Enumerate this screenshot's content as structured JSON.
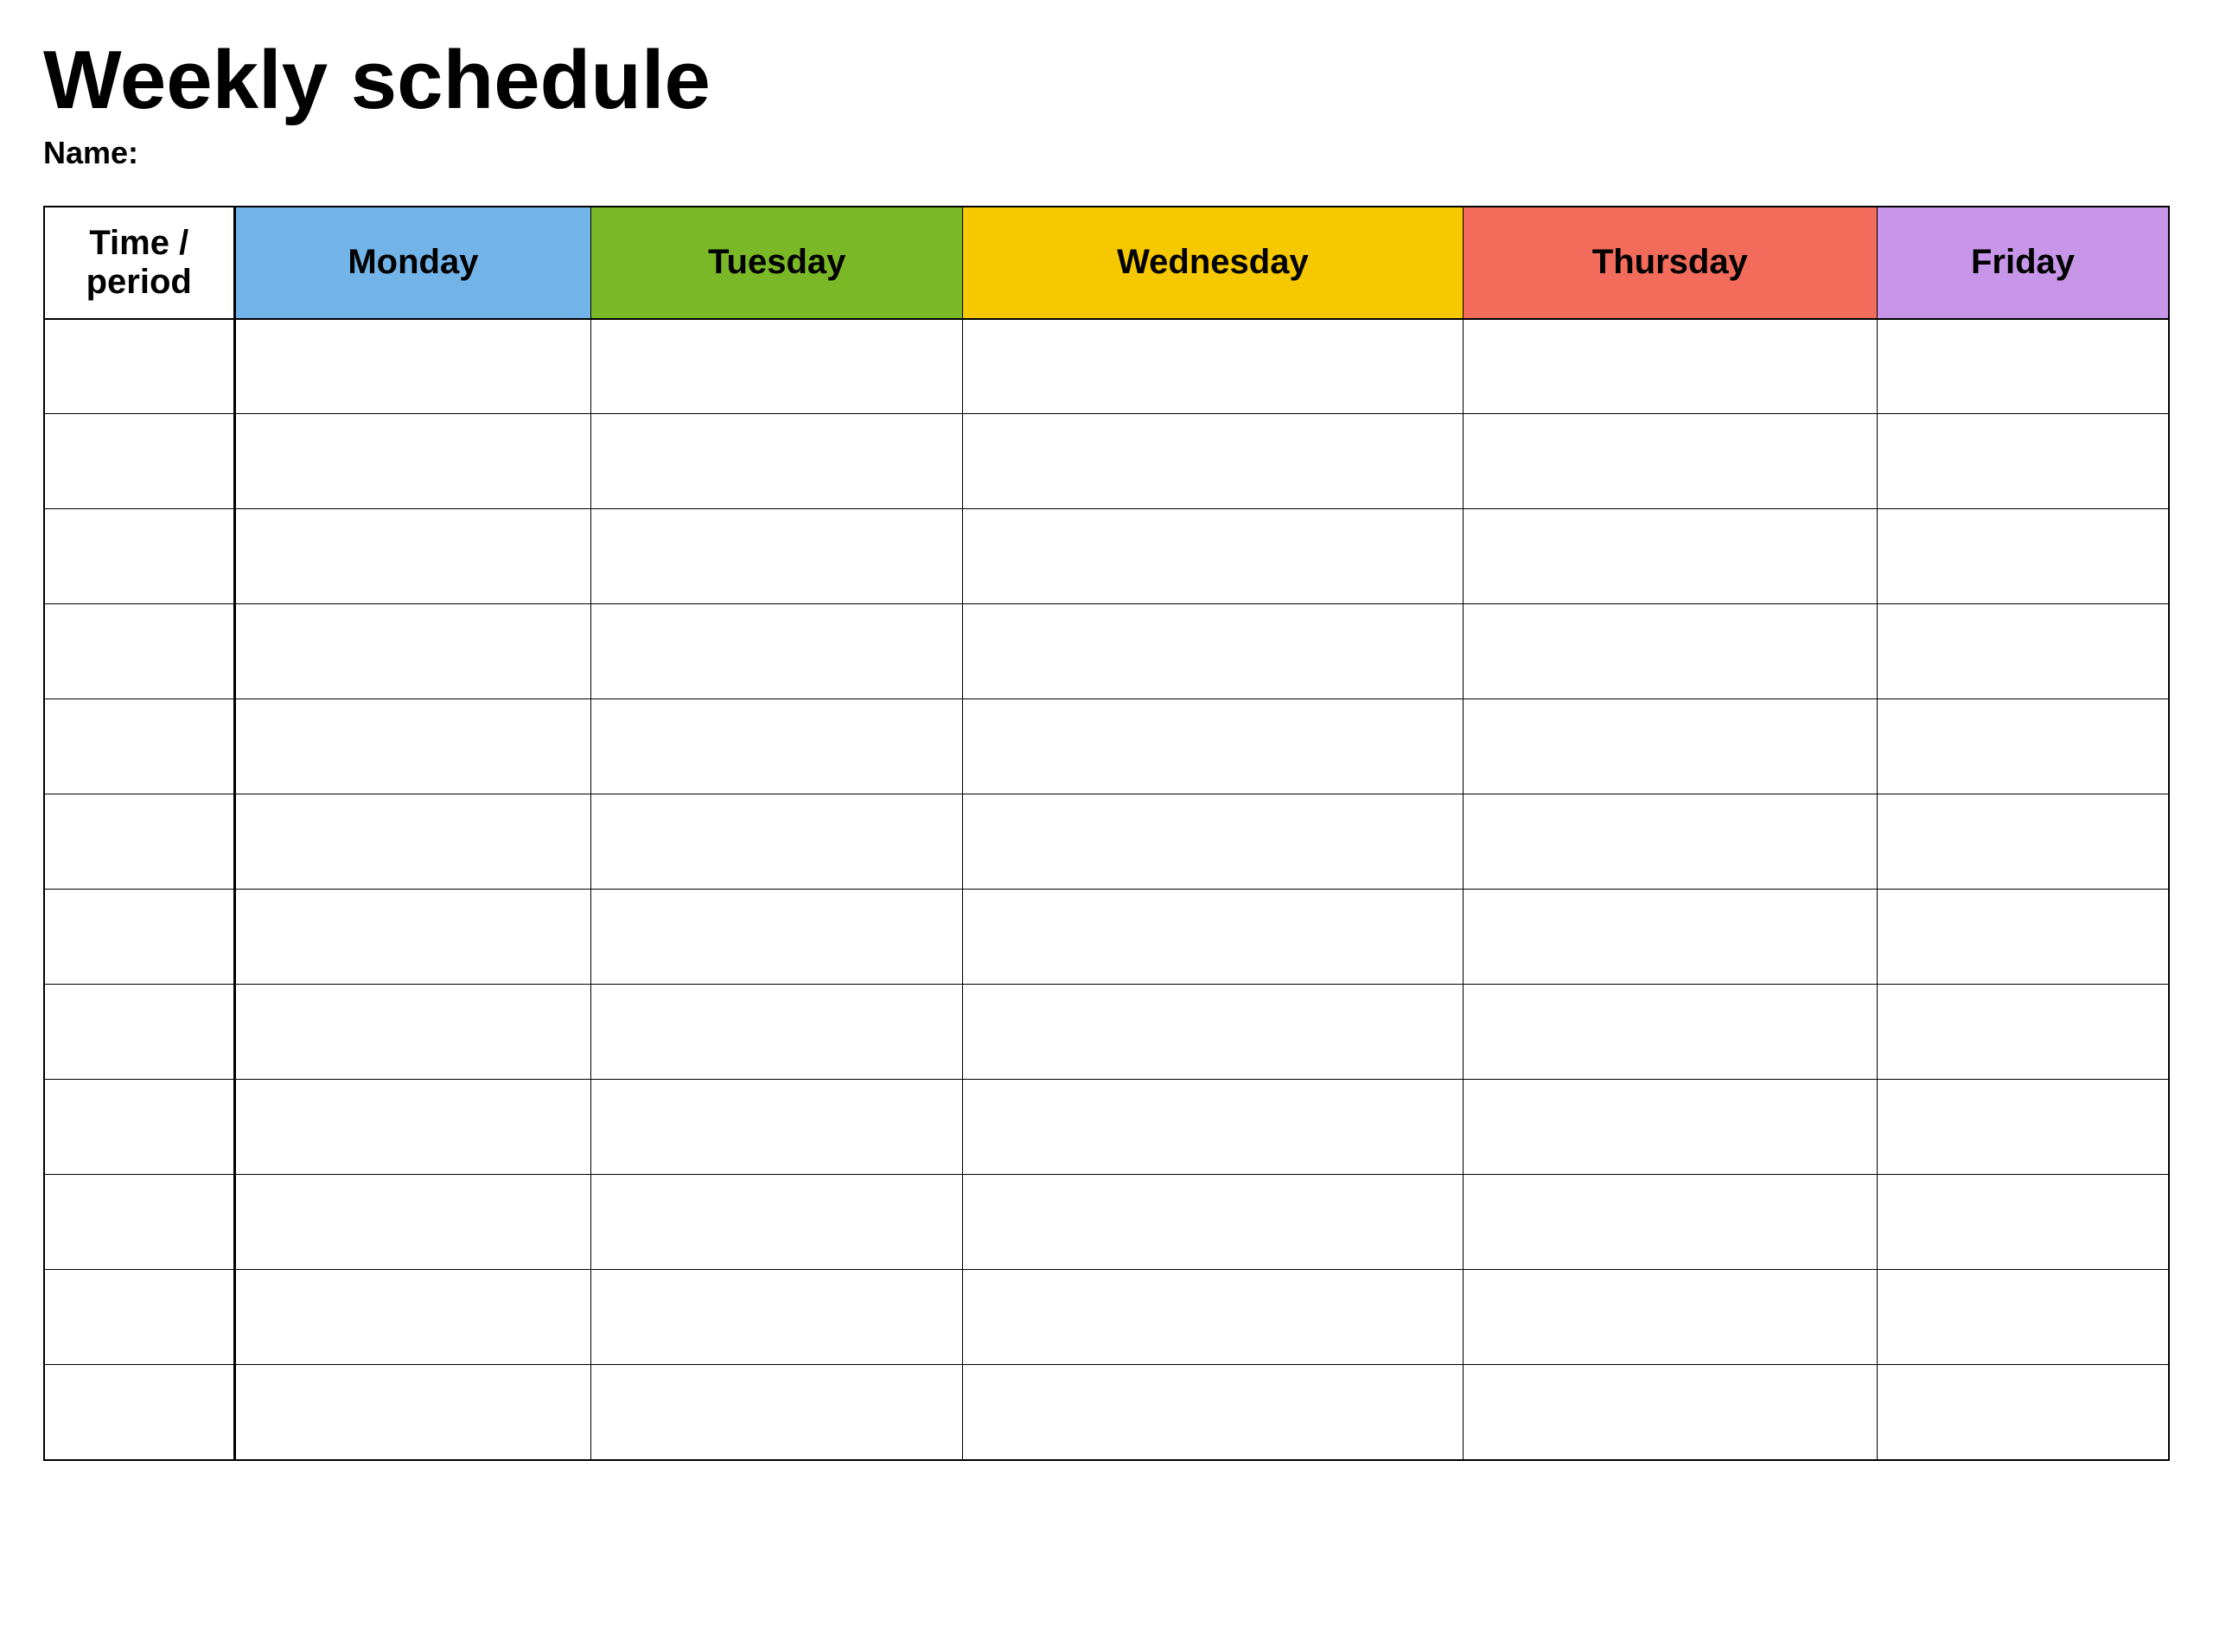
{
  "page": {
    "title": "Weekly schedule",
    "name_label": "Name:"
  },
  "table": {
    "headers": [
      {
        "id": "time",
        "label": "Time / period",
        "class": "col-time"
      },
      {
        "id": "monday",
        "label": "Monday",
        "class": "col-monday"
      },
      {
        "id": "tuesday",
        "label": "Tuesday",
        "class": "col-tuesday"
      },
      {
        "id": "wednesday",
        "label": "Wednesday",
        "class": "col-wednesday"
      },
      {
        "id": "thursday",
        "label": "Thursday",
        "class": "col-thursday"
      },
      {
        "id": "friday",
        "label": "Friday",
        "class": "col-friday"
      }
    ],
    "row_count": 12
  }
}
